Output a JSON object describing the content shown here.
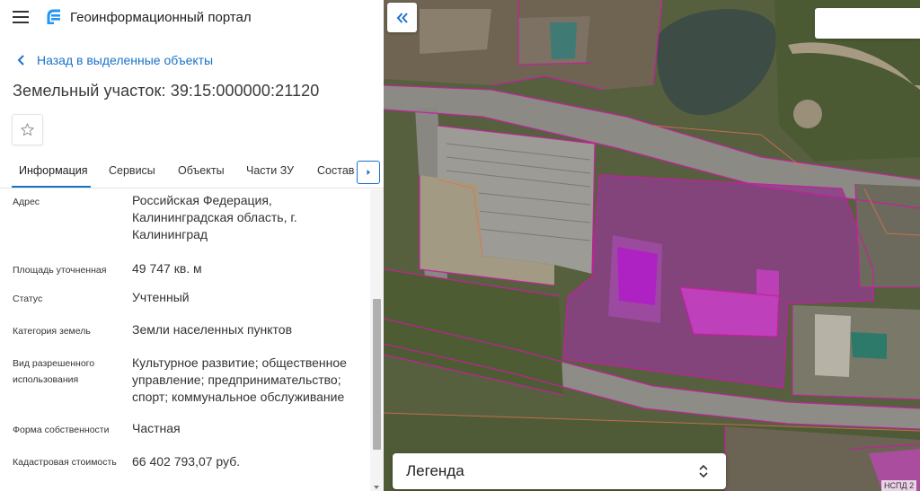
{
  "app": {
    "title": "Геоинформационный портал"
  },
  "back": {
    "label": "Назад в выделенные объекты"
  },
  "parcel": {
    "title": "Земельный участок: 39:15:000000:21120"
  },
  "tabs": [
    {
      "label": "Информация",
      "active": true
    },
    {
      "label": "Сервисы"
    },
    {
      "label": "Объекты"
    },
    {
      "label": "Части ЗУ"
    },
    {
      "label": "Состав"
    }
  ],
  "info": [
    {
      "key": "Адрес",
      "value": "Российская Федерация, Калининградская область, г. Калининград"
    },
    {
      "key": "Площадь уточненная",
      "value": "49 747 кв. м"
    },
    {
      "key": "Статус",
      "value": "Учтенный"
    },
    {
      "key": "Категория земель",
      "value": "Земли населенных пунктов"
    },
    {
      "key": "Вид разрешенного использования",
      "value": "Культурное развитие; общественное управление; предпринимательство; спорт; коммунальное обслуживание"
    },
    {
      "key": "Форма собственности",
      "value": "Частная"
    },
    {
      "key": "Кадастровая стоимость",
      "value": "66 402 793,07 руб."
    }
  ],
  "map": {
    "legend_label": "Легенда",
    "attribution": "НСПД 2"
  },
  "icons": {
    "menu": "hamburger-icon",
    "logo": "portal-logo",
    "back": "chevron-left-icon",
    "favorite": "star-outline-icon",
    "tabs_scroll": "chevron-right-icon",
    "collapse": "double-chevron-left-icon",
    "legend_select": "unfold-icon"
  },
  "colors": {
    "accent": "#1a73c8",
    "parcel_highlight": "#b01ec8",
    "boundary_line": "#c81ea0"
  }
}
